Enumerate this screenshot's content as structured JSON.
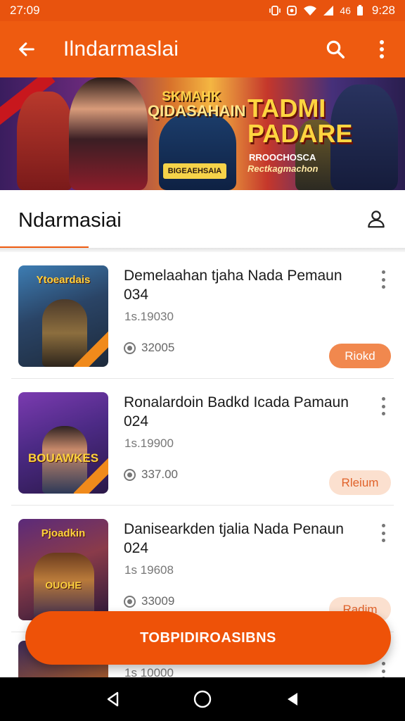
{
  "status_bar": {
    "time_left": "27:09",
    "time_right": "9:28",
    "signal_label": "46"
  },
  "app_bar": {
    "title": "Ilndarmaslai",
    "back_icon": "arrow-left-icon",
    "search_icon": "search-icon",
    "more_icon": "more-vertical-icon"
  },
  "banner": {
    "title_left_line1": "SKMAHK",
    "title_left_line2": "QIDASAHAIN",
    "tagline": "BIGEAEHSAIA",
    "title_right_line1": "TADMI",
    "title_right_line2": "PADARE",
    "small_text_1": "RROOCHOSCA",
    "small_text_2": "Rectkagmachon"
  },
  "section": {
    "title": "Ndarmasiai",
    "profile_icon": "user-icon"
  },
  "items": [
    {
      "title": "Demelaahan tjaha Nada Pemaun 034",
      "date": "1s.19030",
      "stat": "32005",
      "action": "Riokd",
      "thumb_caption": "Ytoeardais"
    },
    {
      "title": "Ronalardoin Badkd Icada Pamaun 024",
      "date": "1s.19900",
      "stat": "337.00",
      "action": "Rleium",
      "thumb_caption": "BOUAWKES"
    },
    {
      "title": "Danisearkden tjalia Nada Penaun 024",
      "date": "1s 19608",
      "stat": "33009",
      "action": "Radim",
      "thumb_caption": "Pjoadkin",
      "thumb_caption_2": "OUOHE"
    }
  ],
  "peek_item": {
    "date": "1s 10000"
  },
  "fab": {
    "label": "TOBPIDIROASIBNS"
  },
  "colors": {
    "accent": "#ee5b10",
    "status_bar": "#e8530e",
    "pill_solid": "#f1884e",
    "pill_soft": "#fbe0cf"
  }
}
